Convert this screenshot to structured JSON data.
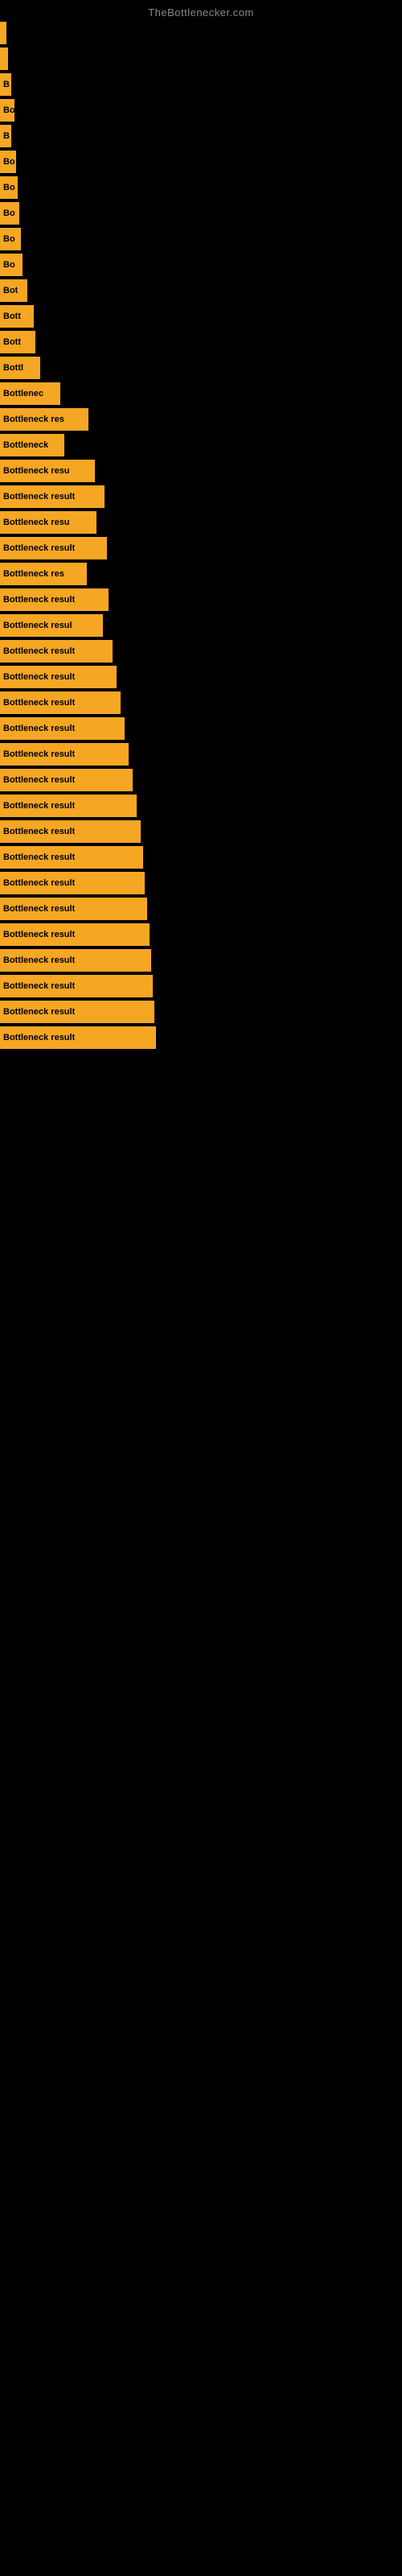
{
  "siteTitle": "TheBottlenecker.com",
  "bars": [
    {
      "label": "",
      "width": 8
    },
    {
      "label": "",
      "width": 10
    },
    {
      "label": "B",
      "width": 14
    },
    {
      "label": "Bo",
      "width": 18
    },
    {
      "label": "B",
      "width": 14
    },
    {
      "label": "Bo",
      "width": 20
    },
    {
      "label": "Bo",
      "width": 22
    },
    {
      "label": "Bo",
      "width": 24
    },
    {
      "label": "Bo",
      "width": 26
    },
    {
      "label": "Bo",
      "width": 28
    },
    {
      "label": "Bot",
      "width": 34
    },
    {
      "label": "Bott",
      "width": 42
    },
    {
      "label": "Bott",
      "width": 44
    },
    {
      "label": "Bottl",
      "width": 50
    },
    {
      "label": "Bottlenec",
      "width": 75
    },
    {
      "label": "Bottleneck res",
      "width": 110
    },
    {
      "label": "Bottleneck",
      "width": 80
    },
    {
      "label": "Bottleneck resu",
      "width": 118
    },
    {
      "label": "Bottleneck result",
      "width": 130
    },
    {
      "label": "Bottleneck resu",
      "width": 120
    },
    {
      "label": "Bottleneck result",
      "width": 133
    },
    {
      "label": "Bottleneck res",
      "width": 108
    },
    {
      "label": "Bottleneck result",
      "width": 135
    },
    {
      "label": "Bottleneck resul",
      "width": 128
    },
    {
      "label": "Bottleneck result",
      "width": 140
    },
    {
      "label": "Bottleneck result",
      "width": 145
    },
    {
      "label": "Bottleneck result",
      "width": 150
    },
    {
      "label": "Bottleneck result",
      "width": 155
    },
    {
      "label": "Bottleneck result",
      "width": 160
    },
    {
      "label": "Bottleneck result",
      "width": 165
    },
    {
      "label": "Bottleneck result",
      "width": 170
    },
    {
      "label": "Bottleneck result",
      "width": 175
    },
    {
      "label": "Bottleneck result",
      "width": 178
    },
    {
      "label": "Bottleneck result",
      "width": 180
    },
    {
      "label": "Bottleneck result",
      "width": 183
    },
    {
      "label": "Bottleneck result",
      "width": 186
    },
    {
      "label": "Bottleneck result",
      "width": 188
    },
    {
      "label": "Bottleneck result",
      "width": 190
    },
    {
      "label": "Bottleneck result",
      "width": 192
    },
    {
      "label": "Bottleneck result",
      "width": 194
    }
  ]
}
